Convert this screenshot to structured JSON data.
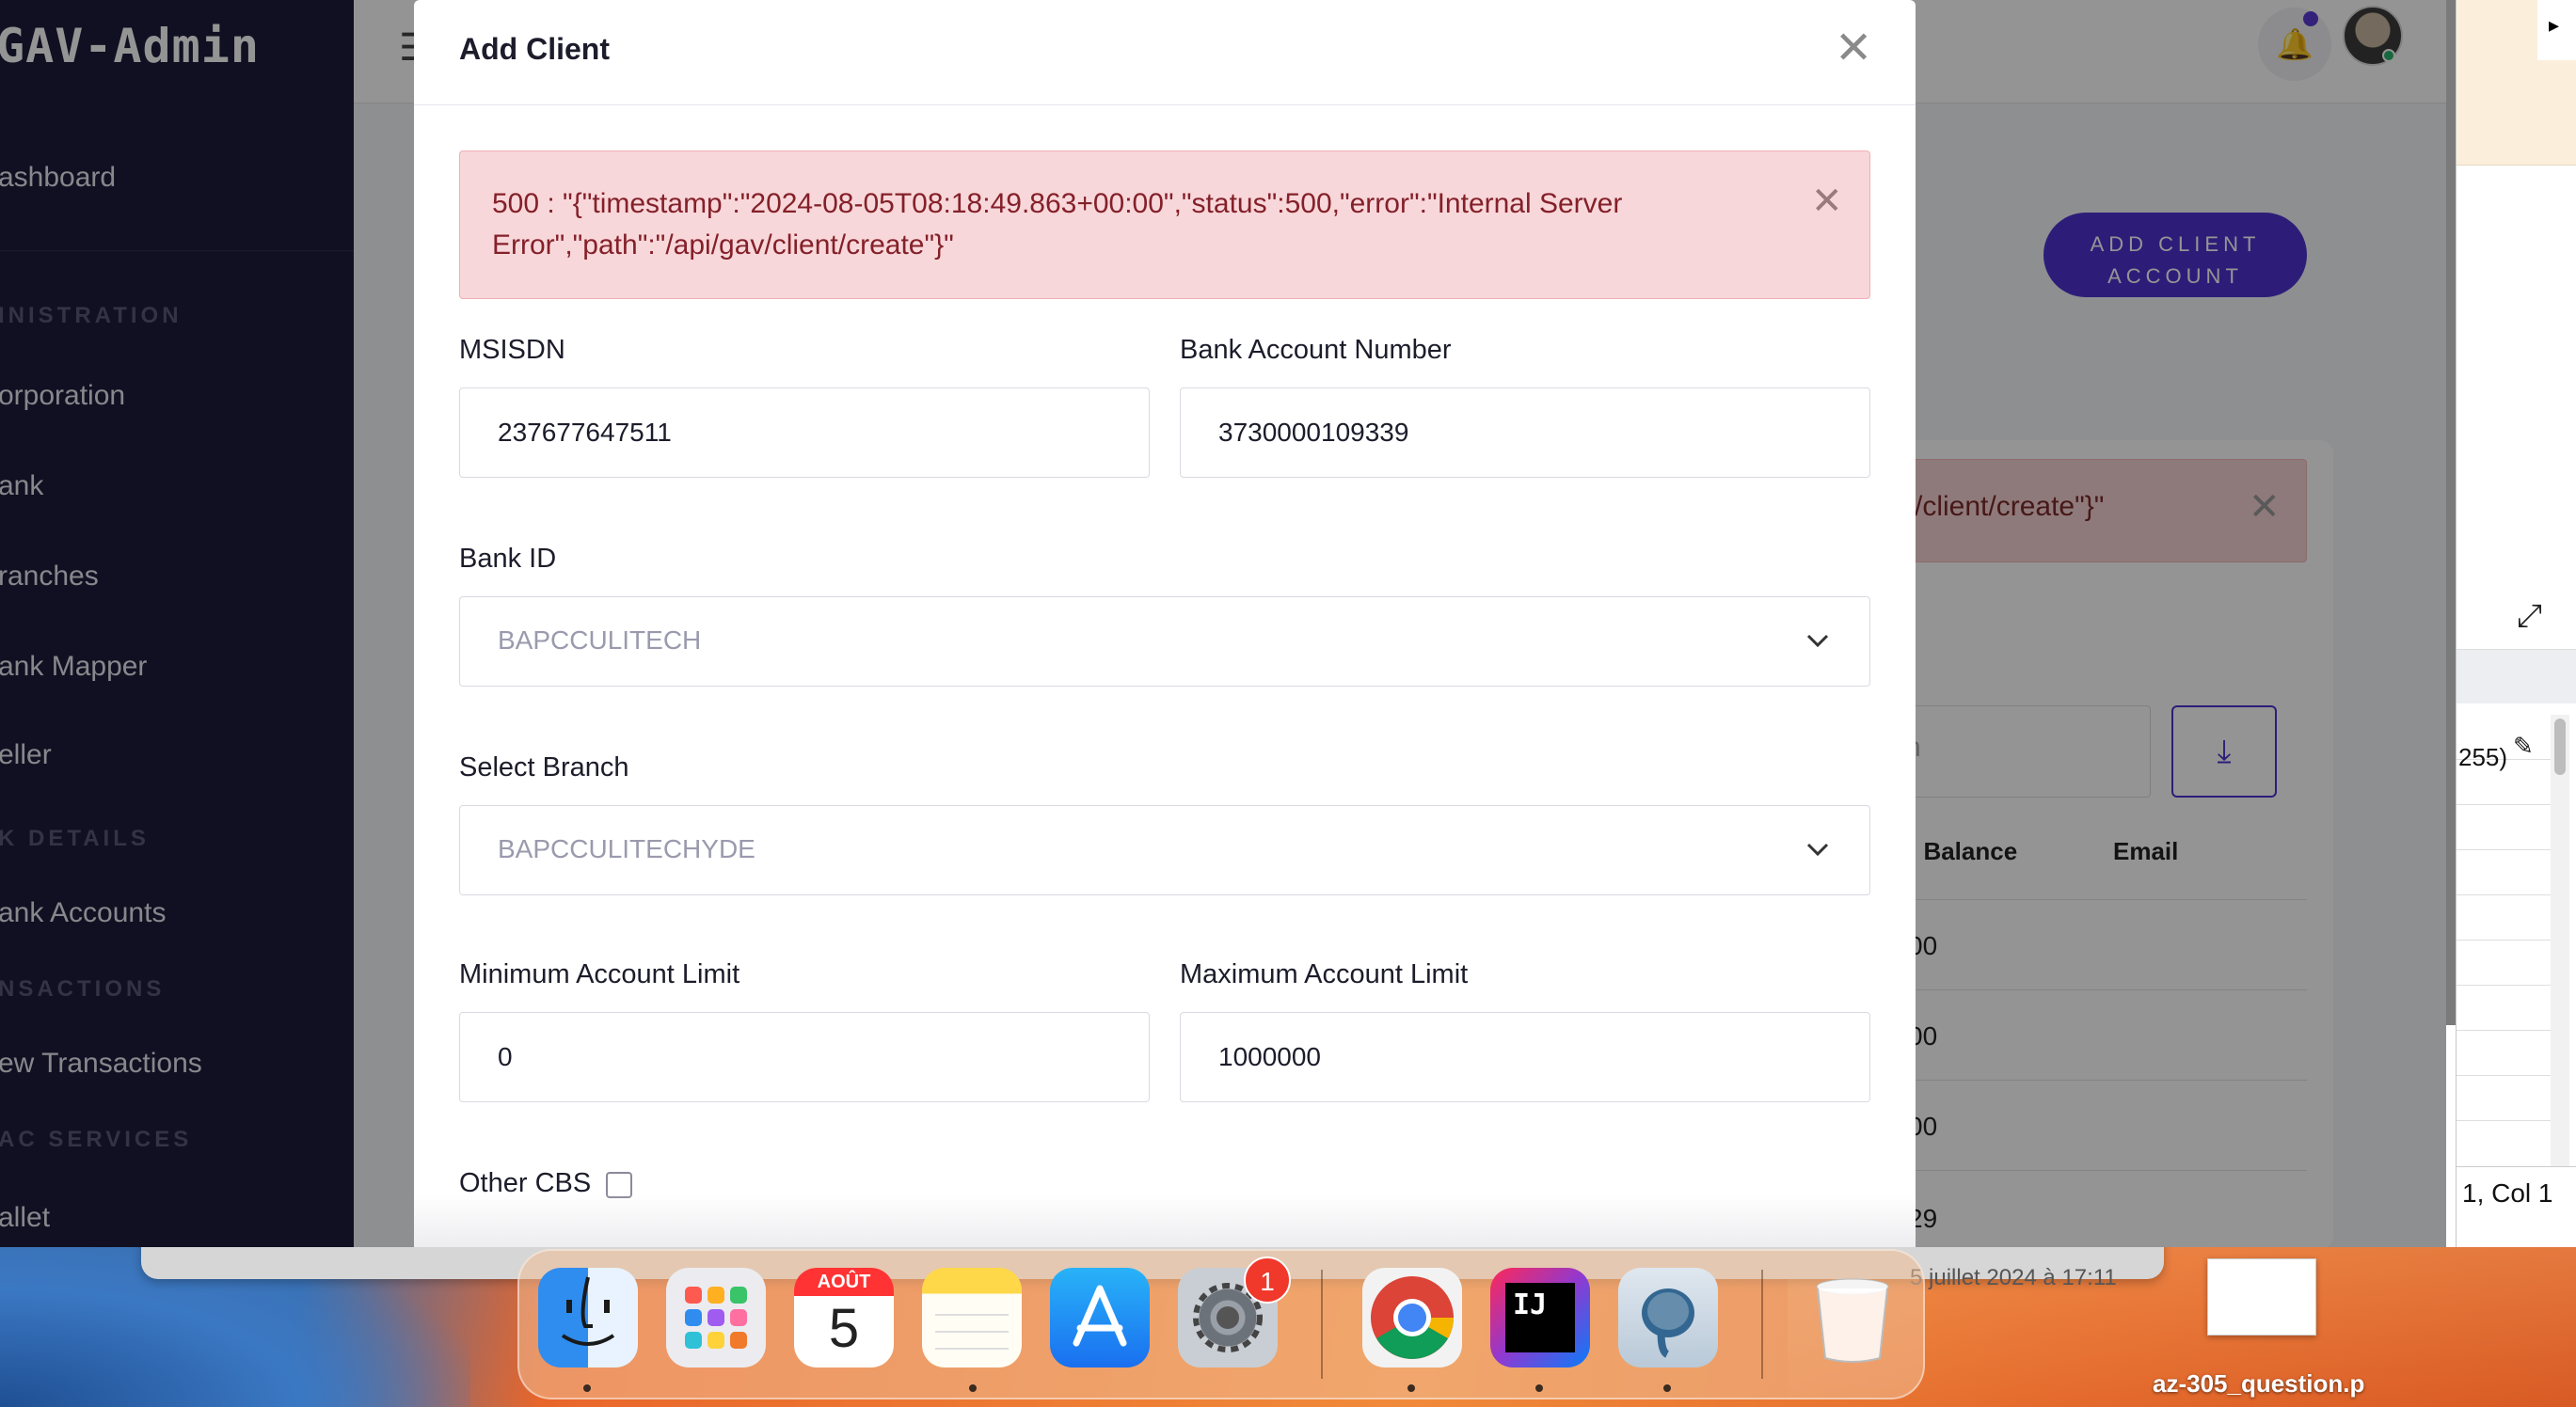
{
  "app": {
    "brand": "GAV-Admin",
    "sidebar": {
      "items": [
        {
          "label": "ashboard"
        },
        {
          "section": "INISTRATION"
        },
        {
          "label": "orporation"
        },
        {
          "label": "ank"
        },
        {
          "label": "ranches"
        },
        {
          "label": "ank Mapper"
        },
        {
          "label": "eller"
        },
        {
          "section": "K DETAILS"
        },
        {
          "label": "ank Accounts"
        },
        {
          "section": "NSACTIONS"
        },
        {
          "label": "ew Transactions"
        },
        {
          "section": "AC SERVICES"
        },
        {
          "label": "allet"
        }
      ]
    },
    "topbar": {
      "menu_icon": "hamburger-icon",
      "bell_icon": "bell-icon",
      "avatar": "user-avatar"
    },
    "add_client_account_label": "ADD CLIENT ACCOUNT",
    "background": {
      "alert_text": "v/client/create\"}\"",
      "search_placeholder": "ch",
      "download_icon": "download-icon",
      "columns": [
        "l Balance",
        "Email"
      ],
      "rows": [
        "00",
        "00",
        "00",
        "29"
      ]
    }
  },
  "modal": {
    "title": "Add Client",
    "error": {
      "text": "500 : \"{\"timestamp\":\"2024-08-05T08:18:49.863+00:00\",\"status\":500,\"error\":\"Internal Server Error\",\"path\":\"/api/gav/client/create\"}\""
    },
    "fields": {
      "msisdn": {
        "label": "MSISDN",
        "value": "237677647511"
      },
      "bank_account_number": {
        "label": "Bank Account Number",
        "value": "3730000109339"
      },
      "bank_id": {
        "label": "Bank ID",
        "value": "BAPCCULITECH"
      },
      "select_branch": {
        "label": "Select Branch",
        "value": "BAPCCULITECHYDE"
      },
      "minimum_account_limit": {
        "label": "Minimum Account Limit",
        "value": "0"
      },
      "maximum_account_limit": {
        "label": "Maximum Account Limit",
        "value": "1000000"
      },
      "other_cbs": {
        "label": "Other CBS",
        "checked": false
      }
    }
  },
  "side_window": {
    "cell_text": "255)",
    "status_text": "1, Col 1"
  },
  "behind_window_text": "5 juillet 2024 à 17:11",
  "dock": {
    "apps": [
      "Finder",
      "Launchpad",
      "Calendar",
      "Notes",
      "App Store",
      "System Settings",
      "Google Chrome",
      "IntelliJ IDEA",
      "pgAdmin"
    ],
    "calendar": {
      "month": "AOÛT",
      "day": "5"
    },
    "settings_badge": "1",
    "intellij_label": "IJ",
    "trash": "Trash"
  },
  "desktop_file": {
    "label": "az-305_question.p"
  },
  "colors": {
    "sidebar_bg": "#1e1c3c",
    "accent": "#4f33d1",
    "alert_bg": "#f8d7da",
    "alert_text": "#842029"
  }
}
